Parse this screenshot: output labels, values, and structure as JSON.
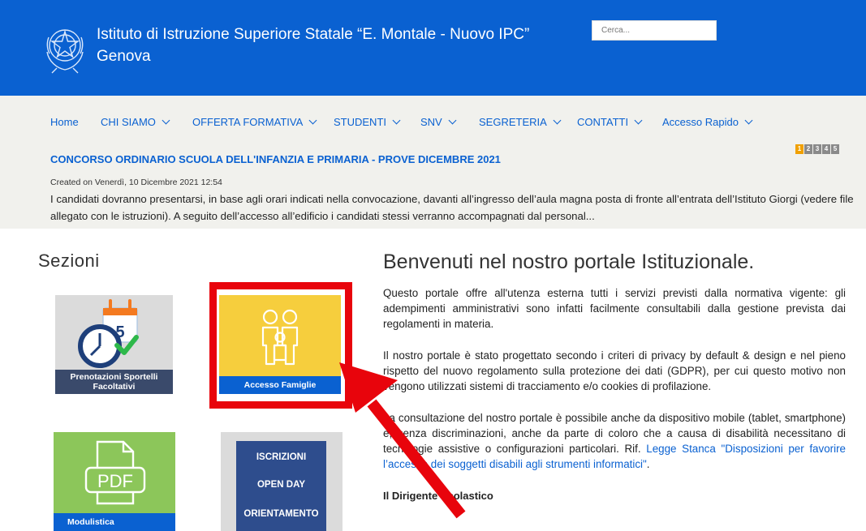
{
  "header": {
    "title_line1": "Istituto di Istruzione Superiore Statale “E. Montale - Nuovo IPC”",
    "title_line2": "Genova",
    "search_placeholder": "Cerca...",
    "emblem_icon": "italian-republic-emblem-icon"
  },
  "nav": {
    "items": [
      {
        "label": "Home",
        "dropdown": false
      },
      {
        "label": "CHI SIAMO",
        "dropdown": true
      },
      {
        "label": "OFFERTA FORMATIVA",
        "dropdown": true
      },
      {
        "label": "STUDENTI",
        "dropdown": true
      },
      {
        "label": "SNV",
        "dropdown": true
      },
      {
        "label": "SEGRETERIA",
        "dropdown": true
      },
      {
        "label": "CONTATTI",
        "dropdown": true
      },
      {
        "label": "Accesso Rapido",
        "dropdown": true
      }
    ]
  },
  "news": {
    "title": "CONCORSO ORDINARIO SCUOLA DELL'INFANZIA E PRIMARIA - PROVE DICEMBRE 2021",
    "meta": "Created on Venerdì, 10 Dicembre 2021 12:54",
    "excerpt": "I candidati dovranno presentarsi, in base agli orari indicati nella convocazione, davanti all’ingresso dell’aula magna posta di fronte all’entrata dell’Istituto Giorgi (vedere file allegato con le istruzioni). A seguito dell’accesso all’edificio i candidati stessi verranno accompagnati dal personal...",
    "pager": [
      "1",
      "2",
      "3",
      "4",
      "5"
    ],
    "pager_active": "1"
  },
  "sections": {
    "title": "Sezioni",
    "tiles": {
      "prenotazioni": "Prenotazioni Sportelli Facoltativi",
      "prenotazioni_calendar_number": "5",
      "famiglie": "Accesso Famiglie",
      "modulistica": "Modulistica",
      "modulistica_icon_text": "PDF",
      "iscrizioni_line1": "ISCRIZIONI",
      "iscrizioni_line2": "OPEN DAY",
      "iscrizioni_line3": "ORIENTAMENTO"
    }
  },
  "main": {
    "title": "Benvenuti nel nostro portale Istituzionale.",
    "p1": "Questo portale offre all'utenza esterna tutti i servizi previsti dalla normativa vigente: gli adempimenti amministrativi sono infatti facilmente consultabili dalla gestione prevista dai regolamenti in materia.",
    "p2": "Il nostro portale è stato progettato secondo i criteri di privacy by default & design e nel pieno rispetto del nuovo regolamento sulla protezione dei dati (GDPR), per cui questo motivo non vengono utilizzati sistemi di tracciamento e/o cookies di profilazione.",
    "p3_text": "La consultazione del nostro portale è possibile anche da dispositivo mobile (tablet, smartphone) e, senza discriminazioni, anche da parte di coloro che a causa di disabilità necessitano di tecnologie assistive o configurazioni particolari. Rif. ",
    "p3_link": "Legge Stanca \"Disposizioni per favorire l’accesso dei soggetti disabili agli strumenti informatici\"",
    "p3_end": ".",
    "signature": "Il Dirigente Scolastico"
  },
  "colors": {
    "brand_blue": "#0a61d1",
    "annotation_red": "#e8040c",
    "tile_yellow": "#f6ce3d",
    "tile_green": "#8cc65a"
  }
}
